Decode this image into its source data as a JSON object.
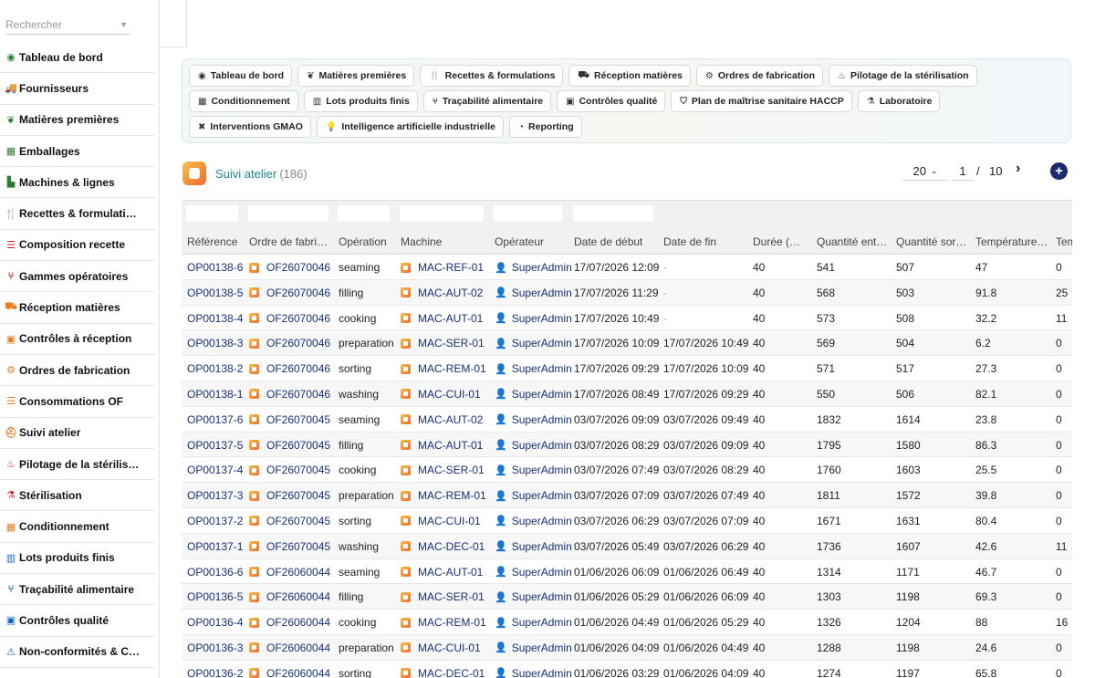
{
  "search": {
    "placeholder": "Rechercher"
  },
  "sidebar": {
    "items": [
      {
        "label": "Tableau de bord",
        "icon": "dashboard-icon",
        "glyph": "◉",
        "color": "#2e7d32"
      },
      {
        "label": "Fournisseurs",
        "icon": "truck-icon",
        "glyph": "🚚",
        "color": "#2e7d32"
      },
      {
        "label": "Matières premières",
        "icon": "seedling-icon",
        "glyph": "❦",
        "color": "#2e7d32"
      },
      {
        "label": "Emballages",
        "icon": "box-icon",
        "glyph": "▦",
        "color": "#2e7d32"
      },
      {
        "label": "Machines & lignes",
        "icon": "industry-icon",
        "glyph": "▙",
        "color": "#2e7d32"
      },
      {
        "label": "Recettes & formulati…",
        "icon": "utensils-icon",
        "glyph": "🍴",
        "color": "#c62828"
      },
      {
        "label": "Composition recette",
        "icon": "list-icon",
        "glyph": "☰",
        "color": "#c62828"
      },
      {
        "label": "Gammes opératoires",
        "icon": "sitemap-icon",
        "glyph": "⑂",
        "color": "#c62828"
      },
      {
        "label": "Réception matières",
        "icon": "dolly-icon",
        "glyph": "⛟",
        "color": "#e67e22"
      },
      {
        "label": "Contrôles à réception",
        "icon": "clipboard-check-icon",
        "glyph": "▣",
        "color": "#e67e22"
      },
      {
        "label": "Ordres de fabrication",
        "icon": "cogs-icon",
        "glyph": "⚙",
        "color": "#e67e22"
      },
      {
        "label": "Consommations OF",
        "icon": "list-icon",
        "glyph": "☰",
        "color": "#e67e22"
      },
      {
        "label": "Suivi atelier",
        "icon": "hard-hat-icon",
        "glyph": "⛑",
        "color": "#e67e22"
      },
      {
        "label": "Pilotage de la stérilis…",
        "icon": "fire-icon",
        "glyph": "♨",
        "color": "#c62828"
      },
      {
        "label": "Stérilisation",
        "icon": "flask-icon",
        "glyph": "⚗",
        "color": "#c62828"
      },
      {
        "label": "Conditionnement",
        "icon": "boxes-icon",
        "glyph": "▦",
        "color": "#e67e22"
      },
      {
        "label": "Lots produits finis",
        "icon": "barcode-icon",
        "glyph": "▥",
        "color": "#1565c0"
      },
      {
        "label": "Traçabilité alimentaire",
        "icon": "sitemap-icon",
        "glyph": "⑂",
        "color": "#1565c0"
      },
      {
        "label": "Contrôles qualité",
        "icon": "clipboard-check-icon",
        "glyph": "▣",
        "color": "#1565c0"
      },
      {
        "label": "Non-conformités & C…",
        "icon": "warning-icon",
        "glyph": "⚠",
        "color": "#1565c0"
      }
    ]
  },
  "shortcuts": [
    {
      "label": "Tableau de bord",
      "icon": "dashboard-icon",
      "glyph": "◉"
    },
    {
      "label": "Matières premières",
      "icon": "seedling-icon",
      "glyph": "❦"
    },
    {
      "label": "Recettes & formulations",
      "icon": "utensils-icon",
      "glyph": "🍴"
    },
    {
      "label": "Réception matières",
      "icon": "dolly-icon",
      "glyph": "⛟"
    },
    {
      "label": "Ordres de fabrication",
      "icon": "cogs-icon",
      "glyph": "⚙"
    },
    {
      "label": "Pilotage de la stérilisation",
      "icon": "fire-icon",
      "glyph": "♨"
    },
    {
      "label": "Conditionnement",
      "icon": "boxes-icon",
      "glyph": "▦"
    },
    {
      "label": "Lots produits finis",
      "icon": "barcode-icon",
      "glyph": "▥"
    },
    {
      "label": "Traçabilité alimentaire",
      "icon": "sitemap-icon",
      "glyph": "⑂"
    },
    {
      "label": "Contrôles qualité",
      "icon": "clipboard-check-icon",
      "glyph": "▣"
    },
    {
      "label": "Plan de maîtrise sanitaire HACCP",
      "icon": "shield-icon",
      "glyph": "⛉"
    },
    {
      "label": "Laboratoire",
      "icon": "flask-icon",
      "glyph": "⚗"
    },
    {
      "label": "Interventions GMAO",
      "icon": "tools-icon",
      "glyph": "✖"
    },
    {
      "label": "Intelligence artificielle industrielle",
      "icon": "lightbulb-icon",
      "glyph": "💡"
    },
    {
      "label": "Reporting",
      "icon": "chart-pie-icon",
      "glyph": "◔"
    }
  ],
  "page": {
    "title": "Suivi atelier",
    "count": "(186)"
  },
  "pager": {
    "page_size": "20",
    "current": "1",
    "separator": "/",
    "total": "10",
    "next_glyph": "›",
    "add_glyph": "+"
  },
  "table": {
    "columns": [
      "Référence",
      "Ordre de fabric…",
      "Opération",
      "Machine",
      "Opérateur",
      "Date de début",
      "Date de fin",
      "Durée (min)",
      "Quantité entr…",
      "Quantité sort…",
      "Température…",
      "Tem"
    ],
    "rows": [
      [
        "OP00138-6",
        "OF26070046",
        "seaming",
        "MAC-REF-01",
        "SuperAdmin",
        "17/07/2026 12:09",
        "-",
        "40",
        "541",
        "507",
        "47",
        "0"
      ],
      [
        "OP00138-5",
        "OF26070046",
        "filling",
        "MAC-AUT-02",
        "SuperAdmin",
        "17/07/2026 11:29",
        "-",
        "40",
        "568",
        "503",
        "91.8",
        "25"
      ],
      [
        "OP00138-4",
        "OF26070046",
        "cooking",
        "MAC-AUT-01",
        "SuperAdmin",
        "17/07/2026 10:49",
        "-",
        "40",
        "573",
        "508",
        "32.2",
        "11"
      ],
      [
        "OP00138-3",
        "OF26070046",
        "preparation",
        "MAC-SER-01",
        "SuperAdmin",
        "17/07/2026 10:09",
        "17/07/2026 10:49",
        "40",
        "569",
        "504",
        "6.2",
        "0"
      ],
      [
        "OP00138-2",
        "OF26070046",
        "sorting",
        "MAC-REM-01",
        "SuperAdmin",
        "17/07/2026 09:29",
        "17/07/2026 10:09",
        "40",
        "571",
        "517",
        "27.3",
        "0"
      ],
      [
        "OP00138-1",
        "OF26070046",
        "washing",
        "MAC-CUI-01",
        "SuperAdmin",
        "17/07/2026 08:49",
        "17/07/2026 09:29",
        "40",
        "550",
        "506",
        "82.1",
        "0"
      ],
      [
        "OP00137-6",
        "OF26070045",
        "seaming",
        "MAC-AUT-02",
        "SuperAdmin",
        "03/07/2026 09:09",
        "03/07/2026 09:49",
        "40",
        "1832",
        "1614",
        "23.8",
        "0"
      ],
      [
        "OP00137-5",
        "OF26070045",
        "filling",
        "MAC-AUT-01",
        "SuperAdmin",
        "03/07/2026 08:29",
        "03/07/2026 09:09",
        "40",
        "1795",
        "1580",
        "86.3",
        "0"
      ],
      [
        "OP00137-4",
        "OF26070045",
        "cooking",
        "MAC-SER-01",
        "SuperAdmin",
        "03/07/2026 07:49",
        "03/07/2026 08:29",
        "40",
        "1760",
        "1603",
        "25.5",
        "0"
      ],
      [
        "OP00137-3",
        "OF26070045",
        "preparation",
        "MAC-REM-01",
        "SuperAdmin",
        "03/07/2026 07:09",
        "03/07/2026 07:49",
        "40",
        "1811",
        "1572",
        "39.8",
        "0"
      ],
      [
        "OP00137-2",
        "OF26070045",
        "sorting",
        "MAC-CUI-01",
        "SuperAdmin",
        "03/07/2026 06:29",
        "03/07/2026 07:09",
        "40",
        "1671",
        "1631",
        "80.4",
        "0"
      ],
      [
        "OP00137-1",
        "OF26070045",
        "washing",
        "MAC-DEC-01",
        "SuperAdmin",
        "03/07/2026 05:49",
        "03/07/2026 06:29",
        "40",
        "1736",
        "1607",
        "42.6",
        "11"
      ],
      [
        "OP00136-6",
        "OF26060044",
        "seaming",
        "MAC-AUT-01",
        "SuperAdmin",
        "01/06/2026 06:09",
        "01/06/2026 06:49",
        "40",
        "1314",
        "1171",
        "46.7",
        "0"
      ],
      [
        "OP00136-5",
        "OF26060044",
        "filling",
        "MAC-SER-01",
        "SuperAdmin",
        "01/06/2026 05:29",
        "01/06/2026 06:09",
        "40",
        "1303",
        "1198",
        "69.3",
        "0"
      ],
      [
        "OP00136-4",
        "OF26060044",
        "cooking",
        "MAC-REM-01",
        "SuperAdmin",
        "01/06/2026 04:49",
        "01/06/2026 05:29",
        "40",
        "1326",
        "1204",
        "88",
        "16"
      ],
      [
        "OP00136-3",
        "OF26060044",
        "preparation",
        "MAC-CUI-01",
        "SuperAdmin",
        "01/06/2026 04:09",
        "01/06/2026 04:49",
        "40",
        "1288",
        "1198",
        "24.6",
        "0"
      ],
      [
        "OP00136-2",
        "OF26060044",
        "sorting",
        "MAC-DEC-01",
        "SuperAdmin",
        "01/06/2026 03:29",
        "01/06/2026 04:09",
        "40",
        "1274",
        "1197",
        "65.8",
        "0"
      ]
    ]
  }
}
